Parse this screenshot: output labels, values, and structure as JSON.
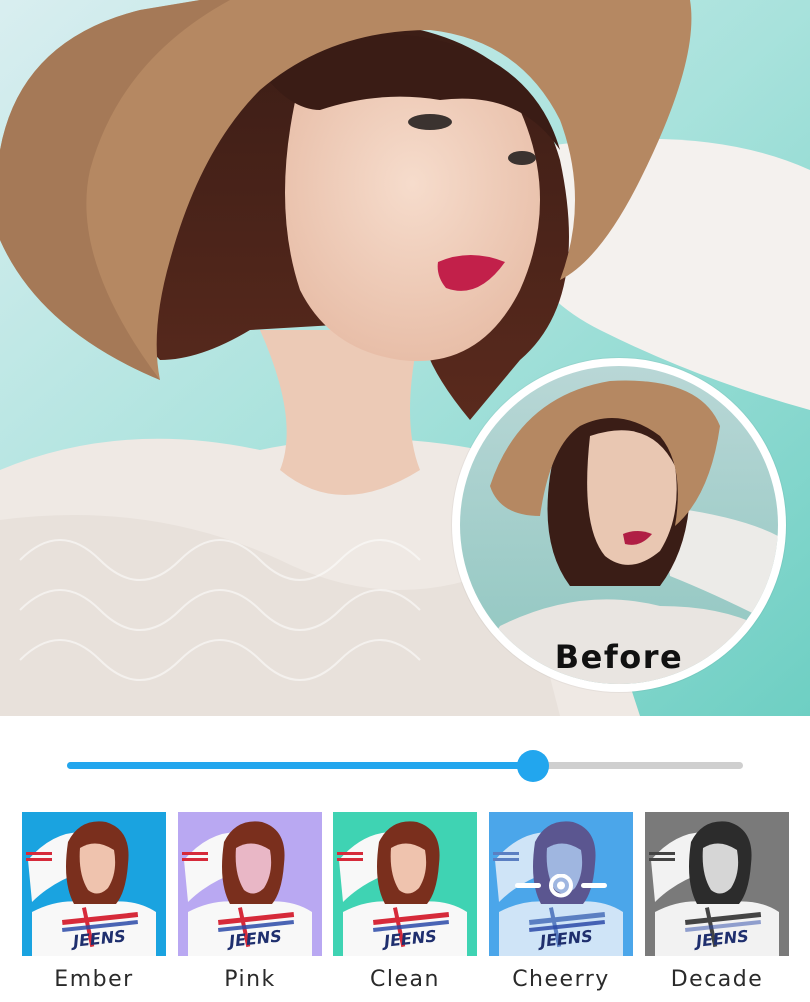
{
  "before_label": "Before",
  "slider": {
    "value_percent": 69,
    "accent": "#22a6ee"
  },
  "filters": [
    {
      "label": "Ember",
      "tint": "#1aa3e0",
      "selected": false
    },
    {
      "label": "Pink",
      "tint": "#b9a8f2",
      "selected": false
    },
    {
      "label": "Clean",
      "tint": "#3fd3b3",
      "selected": false
    },
    {
      "label": "Cheerry",
      "tint": "#4ba6ea",
      "selected": true,
      "icon": "adjust-icon"
    },
    {
      "label": "Decade",
      "tint": "#7a7a7a",
      "selected": false
    }
  ],
  "thumb_text": "JEENS"
}
